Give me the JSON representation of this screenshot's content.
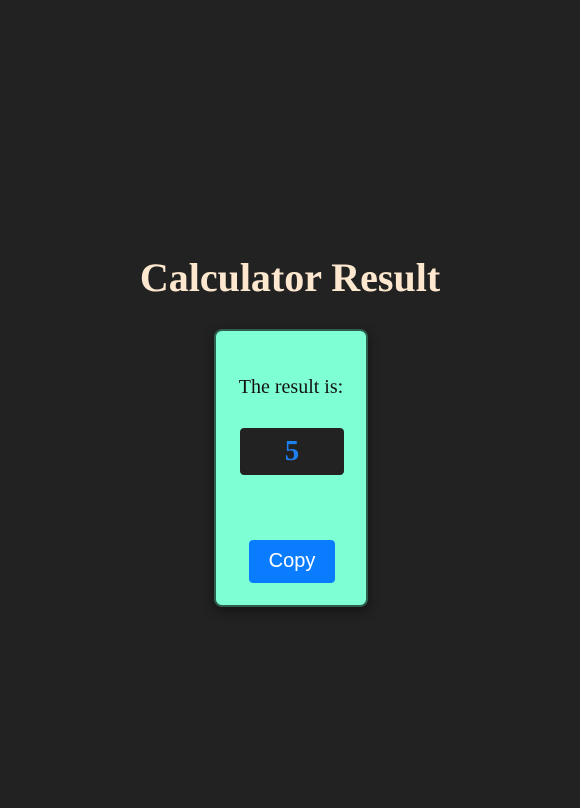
{
  "header": {
    "title": "Calculator Result"
  },
  "result_card": {
    "label": "The result is:",
    "value": "5",
    "copy_label": "Copy"
  },
  "colors": {
    "background": "#222222",
    "title": "#fde8cf",
    "card_background": "#7fffd4",
    "result_text": "#1e7ff0",
    "button_background": "#0a7cff"
  }
}
